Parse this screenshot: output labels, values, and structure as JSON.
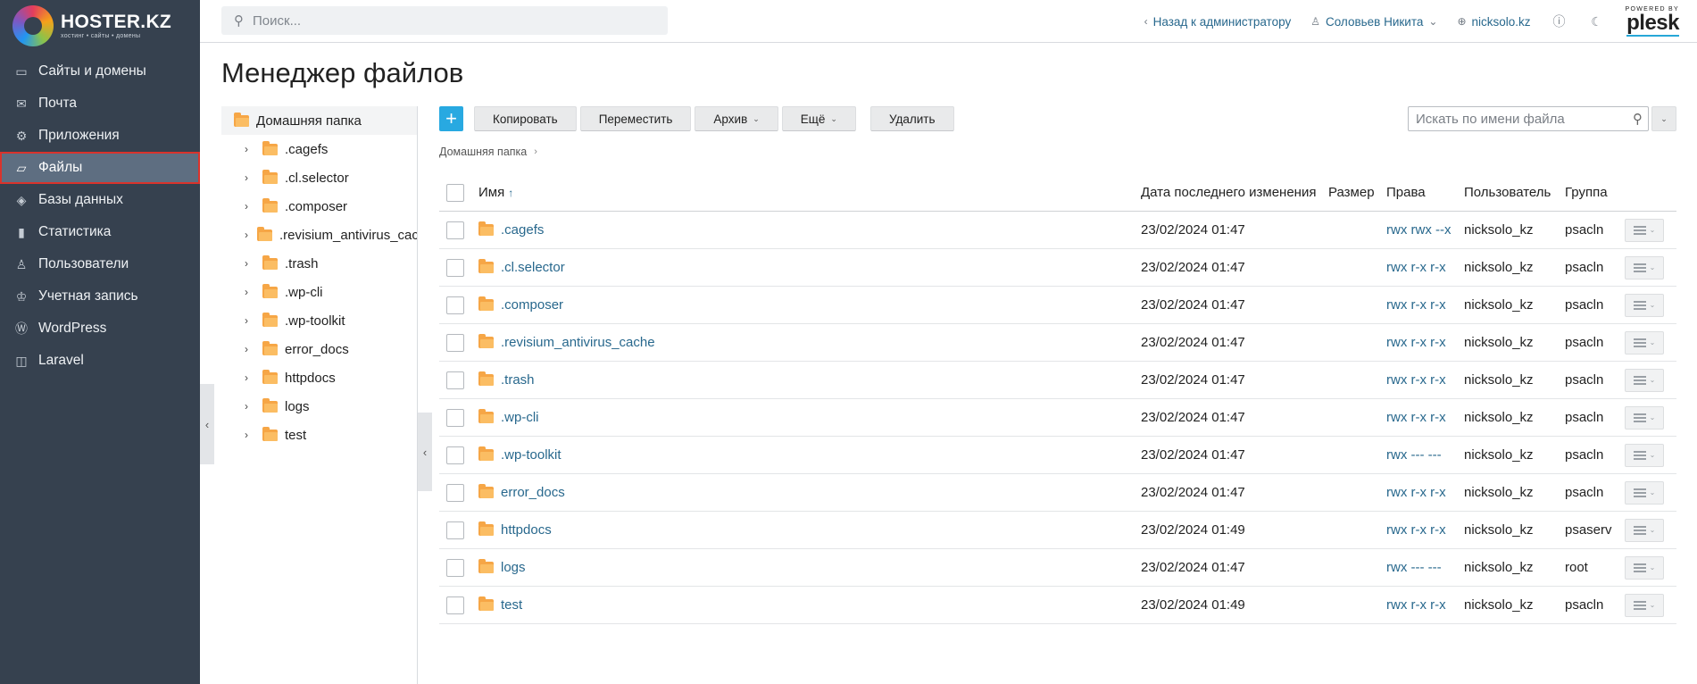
{
  "logo": {
    "brand": "HOSTER.KZ",
    "tagline": "хостинг • сайты • домены"
  },
  "sidebar": {
    "items": [
      {
        "label": "Сайты и домены",
        "icon": "monitor-icon",
        "glyph": "▭"
      },
      {
        "label": "Почта",
        "icon": "mail-icon",
        "glyph": "✉"
      },
      {
        "label": "Приложения",
        "icon": "gear-icon",
        "glyph": "⚙"
      },
      {
        "label": "Файлы",
        "icon": "folder-icon",
        "glyph": "▱",
        "active": true
      },
      {
        "label": "Базы данных",
        "icon": "database-icon",
        "glyph": "◈"
      },
      {
        "label": "Статистика",
        "icon": "chart-icon",
        "glyph": "▮"
      },
      {
        "label": "Пользователи",
        "icon": "user-icon",
        "glyph": "♙"
      },
      {
        "label": "Учетная запись",
        "icon": "account-icon",
        "glyph": "♔"
      },
      {
        "label": "WordPress",
        "icon": "wordpress-icon",
        "glyph": "Ⓦ"
      },
      {
        "label": "Laravel",
        "icon": "laravel-icon",
        "glyph": "◫"
      }
    ]
  },
  "header": {
    "search_placeholder": "Поиск...",
    "back_label": "Назад к администратору",
    "user_label": "Соловьев Никита",
    "domain_label": "nicksolo.kz",
    "powered_by": "POWERED BY",
    "plesk": "plesk"
  },
  "page_title": "Менеджер файлов",
  "tree": {
    "root": "Домашняя папка",
    "items": [
      ".cagefs",
      ".cl.selector",
      ".composer",
      ".revisium_antivirus_cache",
      ".trash",
      ".wp-cli",
      ".wp-toolkit",
      "error_docs",
      "httpdocs",
      "logs",
      "test"
    ]
  },
  "toolbar": {
    "copy": "Копировать",
    "move": "Переместить",
    "archive": "Архив",
    "more": "Ещё",
    "delete": "Удалить",
    "search_placeholder": "Искать по имени файла"
  },
  "breadcrumb": {
    "home": "Домашняя папка"
  },
  "table": {
    "columns": {
      "name": "Имя",
      "date": "Дата последнего изменения",
      "size": "Размер",
      "perm": "Права",
      "user": "Пользователь",
      "group": "Группа"
    },
    "rows": [
      {
        "name": ".cagefs",
        "date": "23/02/2024 01:47",
        "size": "",
        "perm": "rwx rwx --x",
        "user": "nicksolo_kz",
        "group": "psacln"
      },
      {
        "name": ".cl.selector",
        "date": "23/02/2024 01:47",
        "size": "",
        "perm": "rwx r-x r-x",
        "user": "nicksolo_kz",
        "group": "psacln"
      },
      {
        "name": ".composer",
        "date": "23/02/2024 01:47",
        "size": "",
        "perm": "rwx r-x r-x",
        "user": "nicksolo_kz",
        "group": "psacln"
      },
      {
        "name": ".revisium_antivirus_cache",
        "date": "23/02/2024 01:47",
        "size": "",
        "perm": "rwx r-x r-x",
        "user": "nicksolo_kz",
        "group": "psacln"
      },
      {
        "name": ".trash",
        "date": "23/02/2024 01:47",
        "size": "",
        "perm": "rwx r-x r-x",
        "user": "nicksolo_kz",
        "group": "psacln"
      },
      {
        "name": ".wp-cli",
        "date": "23/02/2024 01:47",
        "size": "",
        "perm": "rwx r-x r-x",
        "user": "nicksolo_kz",
        "group": "psacln"
      },
      {
        "name": ".wp-toolkit",
        "date": "23/02/2024 01:47",
        "size": "",
        "perm": "rwx --- ---",
        "user": "nicksolo_kz",
        "group": "psacln"
      },
      {
        "name": "error_docs",
        "date": "23/02/2024 01:47",
        "size": "",
        "perm": "rwx r-x r-x",
        "user": "nicksolo_kz",
        "group": "psacln"
      },
      {
        "name": "httpdocs",
        "date": "23/02/2024 01:49",
        "size": "",
        "perm": "rwx r-x r-x",
        "user": "nicksolo_kz",
        "group": "psaserv"
      },
      {
        "name": "logs",
        "date": "23/02/2024 01:47",
        "size": "",
        "perm": "rwx --- ---",
        "user": "nicksolo_kz",
        "group": "root"
      },
      {
        "name": "test",
        "date": "23/02/2024 01:49",
        "size": "",
        "perm": "rwx r-x r-x",
        "user": "nicksolo_kz",
        "group": "psacln"
      }
    ]
  },
  "colors": {
    "sidebar_bg": "#36414f",
    "active_bg": "#5e6e81",
    "active_outline": "#d9332c",
    "link": "#28688d",
    "accent": "#28a9e1",
    "folder": "#f6a646"
  }
}
